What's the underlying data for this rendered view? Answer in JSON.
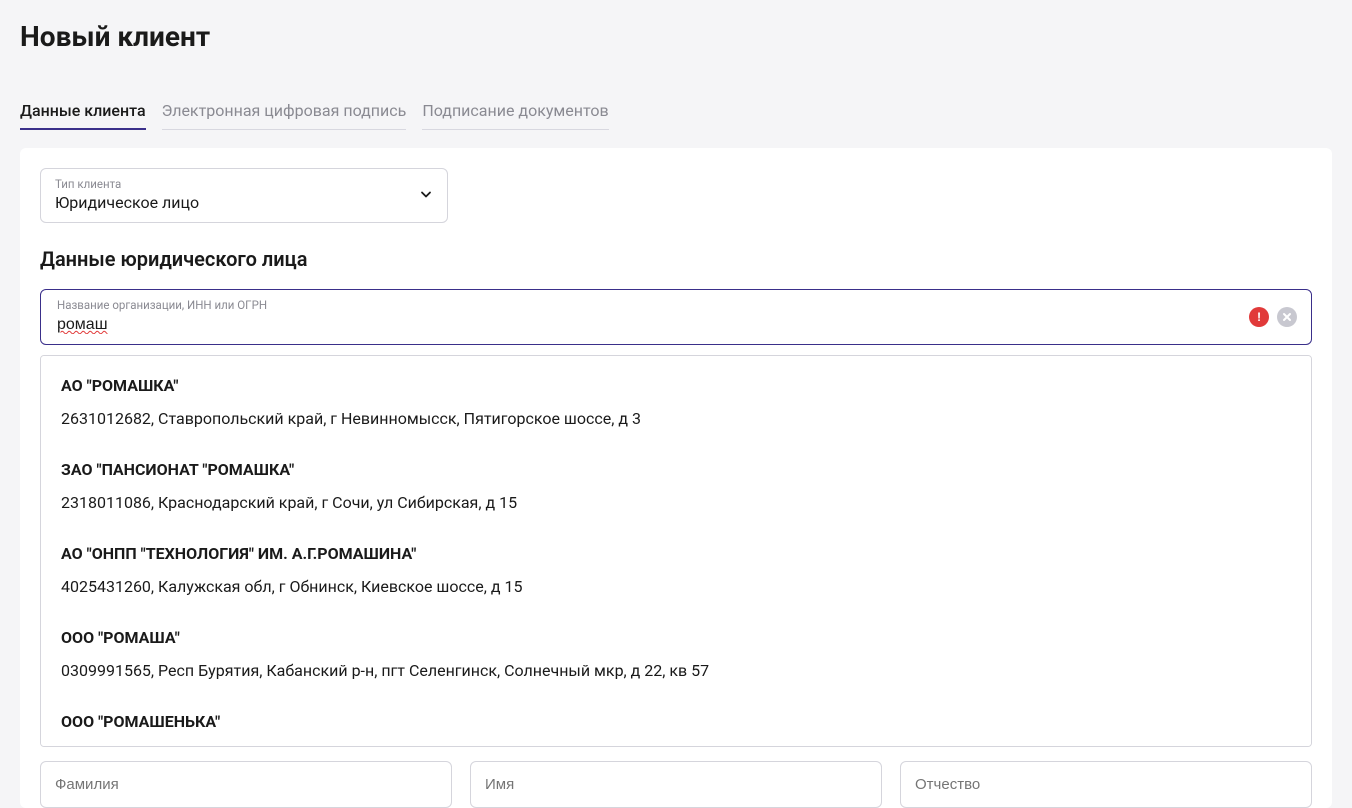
{
  "page_title": "Новый клиент",
  "tabs": [
    {
      "label": "Данные клиента",
      "active": true
    },
    {
      "label": "Электронная цифровая подпись",
      "active": false
    },
    {
      "label": "Подписание документов",
      "active": false
    }
  ],
  "client_type": {
    "label": "Тип клиента",
    "value": "Юридическое лицо"
  },
  "section_title": "Данные юридического лица",
  "org_search": {
    "label": "Название организации, ИНН или ОГРН",
    "value": "ромаш"
  },
  "suggestions": [
    {
      "title": "АО \"РОМАШКА\"",
      "sub": "2631012682, Ставропольский край, г Невинномысск, Пятигорское шоссе, д 3"
    },
    {
      "title": "ЗАО \"ПАНСИОНАТ \"РОМАШКА\"",
      "sub": "2318011086, Краснодарский край, г Сочи, ул Сибирская, д 15"
    },
    {
      "title": "АО \"ОНПП \"ТЕХНОЛОГИЯ\" ИМ. А.Г.РОМАШИНА\"",
      "sub": "4025431260, Калужская обл, г Обнинск, Киевское шоссе, д 15"
    },
    {
      "title": "ООО \"РОМАША\"",
      "sub": "0309991565, Респ Бурятия, Кабанский р-н, пгт Селенгинск, Солнечный мкр, д 22, кв 57"
    },
    {
      "title": "ООО \"РОМАШЕНЬКА\"",
      "sub": ""
    }
  ],
  "name_fields": {
    "surname_placeholder": "Фамилия",
    "firstname_placeholder": "Имя",
    "patronymic_placeholder": "Отчество"
  }
}
